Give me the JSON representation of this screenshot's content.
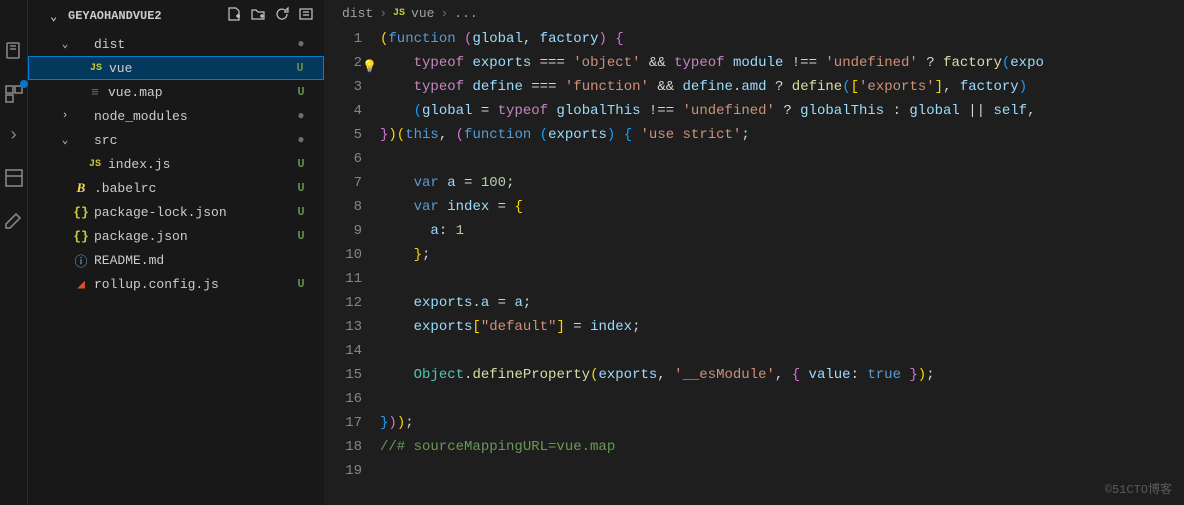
{
  "project_name": "GEYAOHANDVUE2",
  "sidebar_actions": [
    "new-file",
    "new-folder",
    "refresh",
    "collapse"
  ],
  "tree": [
    {
      "name": "dist",
      "type": "folder",
      "open": true,
      "indent": 1,
      "status": "dot"
    },
    {
      "name": "vue",
      "type": "file",
      "icon": "js",
      "indent": 2,
      "status": "U",
      "selected": true
    },
    {
      "name": "vue.map",
      "type": "file",
      "icon": "lines",
      "indent": 2,
      "status": "U"
    },
    {
      "name": "node_modules",
      "type": "folder",
      "open": false,
      "indent": 1,
      "status": "dot"
    },
    {
      "name": "src",
      "type": "folder",
      "open": true,
      "indent": 1,
      "status": "dot"
    },
    {
      "name": "index.js",
      "type": "file",
      "icon": "js",
      "indent": 2,
      "status": "U"
    },
    {
      "name": ".babelrc",
      "type": "file",
      "icon": "babel",
      "indent": 1,
      "status": "U"
    },
    {
      "name": "package-lock.json",
      "type": "file",
      "icon": "json",
      "indent": 1,
      "status": "U"
    },
    {
      "name": "package.json",
      "type": "file",
      "icon": "json",
      "indent": 1,
      "status": "U"
    },
    {
      "name": "README.md",
      "type": "file",
      "icon": "info",
      "indent": 1,
      "status": ""
    },
    {
      "name": "rollup.config.js",
      "type": "file",
      "icon": "rollup",
      "indent": 1,
      "status": "U"
    }
  ],
  "breadcrumb": {
    "parts": [
      "dist",
      "vue",
      "..."
    ],
    "file_icon": "JS"
  },
  "code_lines": 19,
  "code_html": [
    "<span class='tok-p'>(</span><span class='tok-kw'>function</span> <span class='tok-p2'>(</span><span class='tok-var'>global</span>, <span class='tok-var'>factory</span><span class='tok-p2'>)</span> <span class='tok-p2'>{</span>",
    "    <span class='tok-kw2'>typeof</span> <span class='tok-var'>exports</span> <span class='tok-op'>===</span> <span class='tok-str'>'object'</span> <span class='tok-op'>&amp;&amp;</span> <span class='tok-kw2'>typeof</span> <span class='tok-var'>module</span> <span class='tok-op'>!==</span> <span class='tok-str'>'undefined'</span> <span class='tok-op'>?</span> <span class='tok-fn'>factory</span><span class='tok-p3'>(</span><span class='tok-var'>expo</span>",
    "    <span class='tok-kw2'>typeof</span> <span class='tok-var'>define</span> <span class='tok-op'>===</span> <span class='tok-str'>'function'</span> <span class='tok-op'>&amp;&amp;</span> <span class='tok-var'>define</span>.<span class='tok-var'>amd</span> <span class='tok-op'>?</span> <span class='tok-fn'>define</span><span class='tok-p3'>(</span><span class='tok-p'>[</span><span class='tok-str'>'exports'</span><span class='tok-p'>]</span>, <span class='tok-var'>factory</span><span class='tok-p3'>)</span>",
    "    <span class='tok-p3'>(</span><span class='tok-var'>global</span> <span class='tok-op'>=</span> <span class='tok-kw2'>typeof</span> <span class='tok-var'>globalThis</span> <span class='tok-op'>!==</span> <span class='tok-str'>'undefined'</span> <span class='tok-op'>?</span> <span class='tok-var'>globalThis</span> <span class='tok-op'>:</span> <span class='tok-var'>global</span> <span class='tok-op'>||</span> <span class='tok-var'>self</span>,",
    "<span class='tok-p2'>}</span><span class='tok-p'>)(</span><span class='tok-kw'>this</span>, <span class='tok-p2'>(</span><span class='tok-kw'>function</span> <span class='tok-p3'>(</span><span class='tok-var'>exports</span><span class='tok-p3'>)</span> <span class='tok-p3'>{</span> <span class='tok-str'>'use strict'</span>;",
    "",
    "    <span class='tok-kw'>var</span> <span class='tok-var'>a</span> <span class='tok-op'>=</span> <span class='tok-num'>100</span>;",
    "    <span class='tok-kw'>var</span> <span class='tok-var'>index</span> <span class='tok-op'>=</span> <span class='tok-p'>{</span>",
    "      <span class='tok-var'>a</span>: <span class='tok-num'>1</span>",
    "    <span class='tok-p'>}</span>;",
    "",
    "    <span class='tok-var'>exports</span>.<span class='tok-var'>a</span> <span class='tok-op'>=</span> <span class='tok-var'>a</span>;",
    "    <span class='tok-var'>exports</span><span class='tok-p'>[</span><span class='tok-str'>\"default\"</span><span class='tok-p'>]</span> <span class='tok-op'>=</span> <span class='tok-var'>index</span>;",
    "",
    "    <span class='tok-obj'>Object</span>.<span class='tok-fn'>defineProperty</span><span class='tok-p'>(</span><span class='tok-var'>exports</span>, <span class='tok-str'>'__esModule'</span>, <span class='tok-p2'>{</span> <span class='tok-var'>value</span>: <span class='tok-kw'>true</span> <span class='tok-p2'>}</span><span class='tok-p'>)</span>;",
    "",
    "<span class='tok-p3'>}</span><span class='tok-p2'>)</span><span class='tok-p'>)</span>;",
    "<span class='tok-cmt'>//# sourceMappingURL=vue.map</span>",
    ""
  ],
  "watermark": "©51CTO博客",
  "bulb_line": 2
}
